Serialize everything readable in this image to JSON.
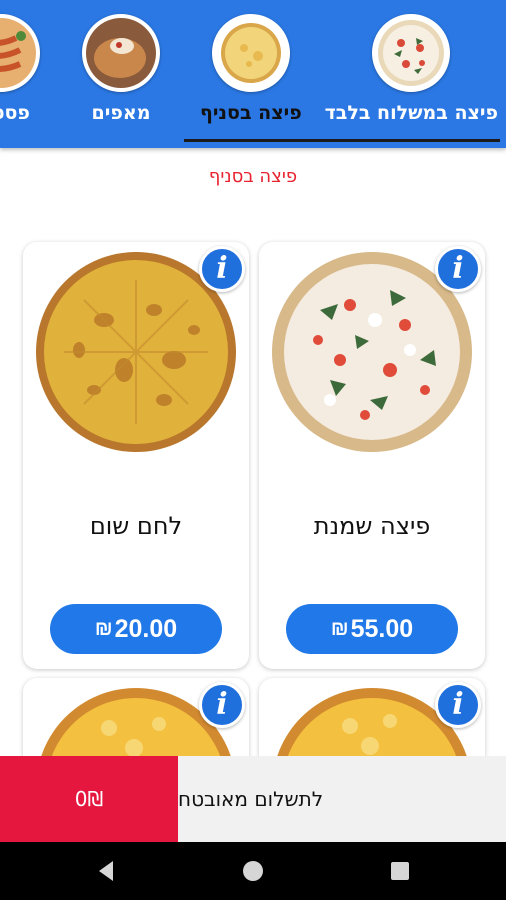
{
  "categories": [
    {
      "label": "פיצה במשלוח בלבד",
      "active": false
    },
    {
      "label": "פיצה בסניף",
      "active": true
    },
    {
      "label": "מאפים",
      "active": false
    },
    {
      "label": "פסטות",
      "active": false
    }
  ],
  "section_title": "פיצה בסניף",
  "products": [
    {
      "name": "פיצה שמנת",
      "price": "55.00",
      "currency": "₪"
    },
    {
      "name": "לחם שום",
      "price": "20.00",
      "currency": "₪"
    }
  ],
  "info_icon_glyph": "i",
  "checkout": {
    "total": "0₪",
    "secure_payment_label": "לתשלום מאובטח"
  },
  "colors": {
    "accent_blue": "#2b78e4",
    "section_title_red": "#e8222e",
    "cart_total_red": "#e5173f",
    "price_button_blue": "#2178e8"
  },
  "icons": [
    "info-icon",
    "back-icon",
    "home-icon",
    "recents-icon"
  ]
}
